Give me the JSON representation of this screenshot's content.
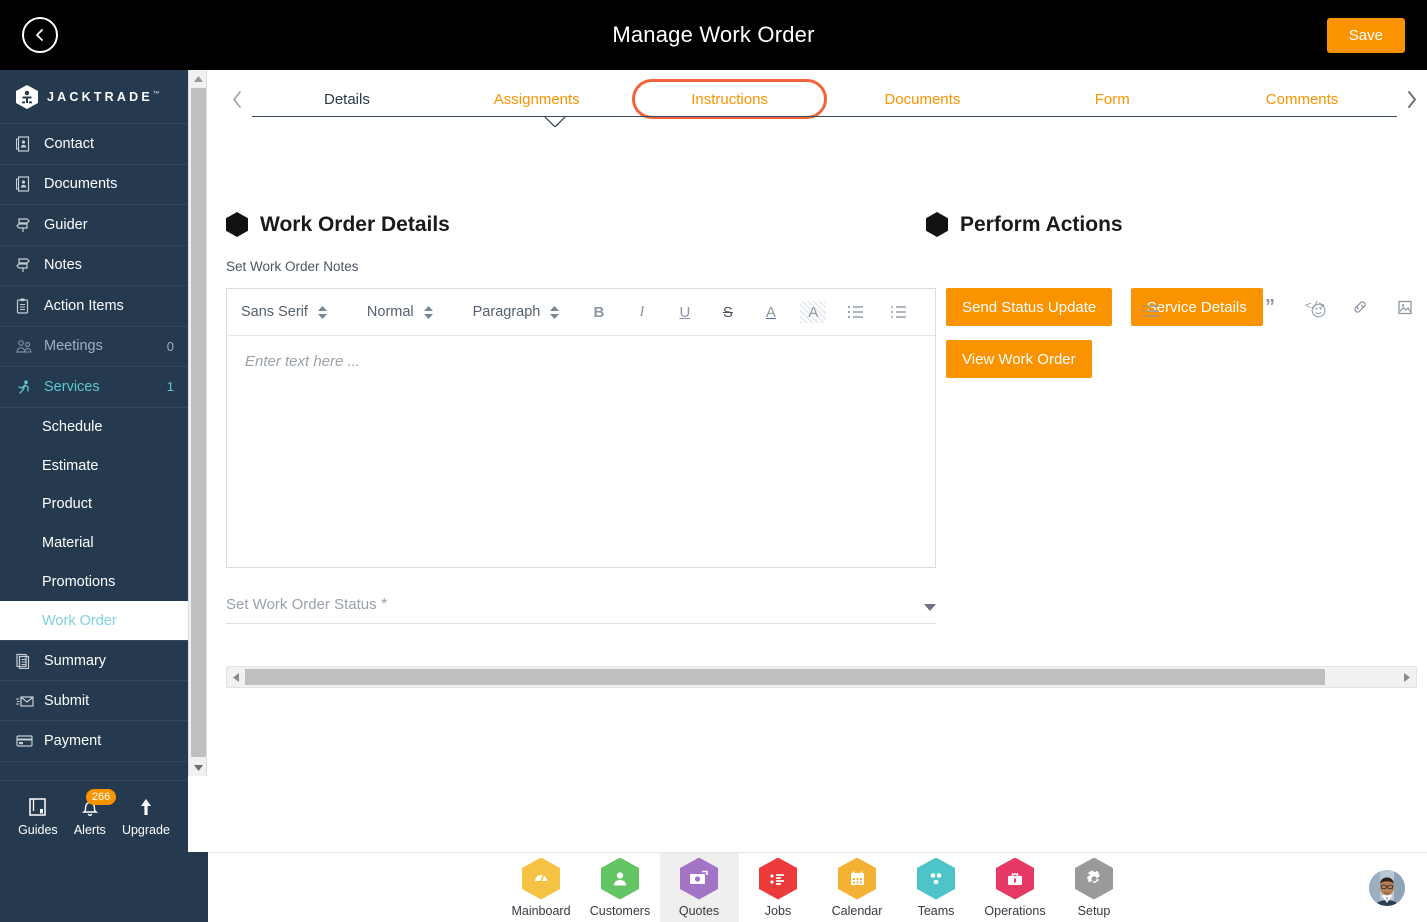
{
  "header": {
    "title": "Manage Work Order",
    "back_icon": "chevron-left-circle-icon",
    "save_label": "Save"
  },
  "sidebar": {
    "brand": "JACKTRADE",
    "brand_tm": "™",
    "items": [
      {
        "label": "Contact",
        "icon": "contact-card-icon",
        "count": ""
      },
      {
        "label": "Documents",
        "icon": "documents-icon",
        "count": ""
      },
      {
        "label": "Guider",
        "icon": "signpost-icon",
        "count": ""
      },
      {
        "label": "Notes",
        "icon": "signpost-icon",
        "count": ""
      },
      {
        "label": "Action Items",
        "icon": "clipboard-icon",
        "count": ""
      },
      {
        "label": "Meetings",
        "icon": "meetings-icon",
        "count": "0"
      },
      {
        "label": "Services",
        "icon": "services-icon",
        "count": "1"
      }
    ],
    "sub_items": [
      {
        "label": "Schedule"
      },
      {
        "label": "Estimate"
      },
      {
        "label": "Product"
      },
      {
        "label": "Material"
      },
      {
        "label": "Promotions"
      },
      {
        "label": "Work Order"
      }
    ],
    "items_after": [
      {
        "label": "Summary",
        "icon": "summary-icon",
        "count": ""
      },
      {
        "label": "Submit",
        "icon": "submit-mail-icon",
        "count": ""
      },
      {
        "label": "Payment",
        "icon": "payment-card-icon",
        "count": ""
      }
    ],
    "tools": [
      {
        "label": "Guides",
        "icon": "book-icon",
        "badge": ""
      },
      {
        "label": "Alerts",
        "icon": "bell-icon",
        "badge": "266"
      },
      {
        "label": "Upgrade",
        "icon": "upgrade-arrow-icon",
        "badge": ""
      }
    ],
    "hex_shortcuts": [
      {
        "icon": "person-hex-icon"
      },
      {
        "icon": "dollar-hex-icon"
      },
      {
        "icon": "money-transfer-hex-icon"
      },
      {
        "icon": "workflow-hex-icon"
      }
    ]
  },
  "tabs": {
    "prev_icon": "chevron-left-icon",
    "next_icon": "chevron-right-icon",
    "items": [
      {
        "label": "Details",
        "state": "current"
      },
      {
        "label": "Assignments",
        "state": "normal"
      },
      {
        "label": "Instructions",
        "state": "highlighted"
      },
      {
        "label": "Documents",
        "state": "normal"
      },
      {
        "label": "Form",
        "state": "normal"
      },
      {
        "label": "Comments",
        "state": "normal"
      }
    ]
  },
  "main": {
    "left_section_title": "Work Order Details",
    "right_section_title": "Perform Actions",
    "notes_label": "Set Work Order Notes",
    "editor": {
      "font_family_value": "Sans Serif",
      "font_size_value": "Normal",
      "block_value": "Paragraph",
      "buttons": [
        {
          "name": "bold-icon",
          "glyph": "B"
        },
        {
          "name": "italic-icon",
          "glyph": "I"
        },
        {
          "name": "underline-icon",
          "glyph": "U"
        },
        {
          "name": "strikethrough-icon",
          "glyph": "S"
        },
        {
          "name": "text-color-icon",
          "glyph": "A"
        },
        {
          "name": "highlight-color-icon",
          "glyph": "A"
        },
        {
          "name": "ordered-list-icon",
          "glyph": "list"
        },
        {
          "name": "unordered-list-icon",
          "glyph": "list"
        }
      ],
      "placeholder": "Enter text here ...",
      "right_icons": [
        {
          "name": "blockquote-icon",
          "glyph": "”"
        },
        {
          "name": "code-block-icon",
          "glyph": "</>"
        },
        {
          "name": "link-icon",
          "glyph": "link"
        },
        {
          "name": "image-icon",
          "glyph": "image"
        }
      ],
      "emoji_icon": "smiley-icon"
    },
    "status_field": {
      "label": "Set Work Order Status",
      "required_mark": "*",
      "value": "",
      "caret_icon": "chevron-down-icon"
    },
    "actions": [
      {
        "label": "Send Status Update"
      },
      {
        "label": "Service Details"
      },
      {
        "label": "View Work Order"
      }
    ],
    "hscroll": {
      "left_icon": "scroll-left-icon",
      "right_icon": "scroll-right-icon"
    }
  },
  "bottom_nav": {
    "items": [
      {
        "label": "Mainboard",
        "icon": "mainboard-icon",
        "color": "#f5c343",
        "selected": false
      },
      {
        "label": "Customers",
        "icon": "customers-icon",
        "color": "#62c462",
        "selected": false
      },
      {
        "label": "Quotes",
        "icon": "quotes-icon",
        "color": "#a374c6",
        "selected": true
      },
      {
        "label": "Jobs",
        "icon": "jobs-icon",
        "color": "#ed3b3b",
        "selected": false
      },
      {
        "label": "Calendar",
        "icon": "calendar-icon",
        "color": "#f3b233",
        "selected": false
      },
      {
        "label": "Teams",
        "icon": "teams-icon",
        "color": "#4cc4c8",
        "selected": false
      },
      {
        "label": "Operations",
        "icon": "operations-icon",
        "color": "#e63966",
        "selected": false
      },
      {
        "label": "Setup",
        "icon": "setup-gear-icon",
        "color": "#9a9a9a",
        "selected": false
      }
    ],
    "avatar": "user-avatar"
  },
  "colors": {
    "accent_orange": "#f99300",
    "highlight_orange": "#f4623a",
    "sidebar_bg": "#25394f",
    "teal": "#4cc4c8"
  }
}
